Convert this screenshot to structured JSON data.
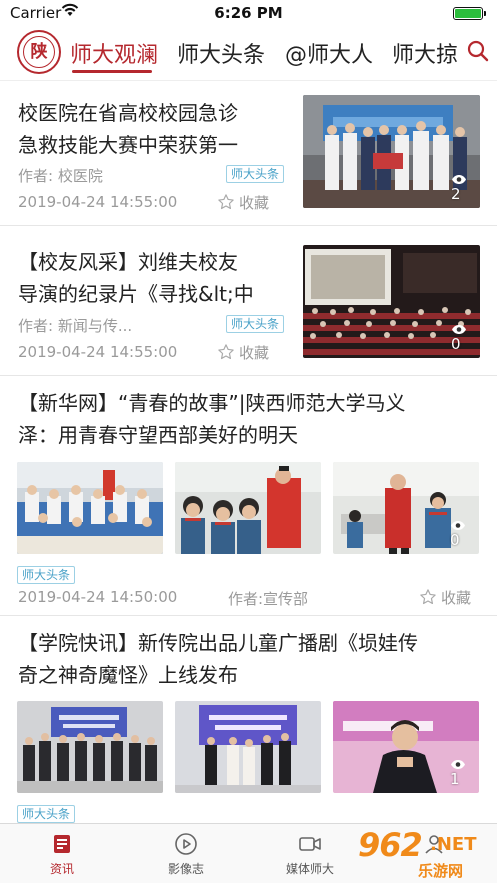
{
  "status": {
    "carrier": "Carrier",
    "time": "6:26 PM"
  },
  "logo": {
    "char": "陕"
  },
  "nav": {
    "tabs": [
      "师大观澜",
      "师大头条",
      "@师大人",
      "师大掠"
    ],
    "active": 0
  },
  "articles": [
    {
      "title_lines": [
        "校医院在省高校校园急诊",
        "急救技能大赛中荣获第一"
      ],
      "author": "作者: 校医院",
      "tag": "师大头条",
      "date": "2019-04-24 14:55:00",
      "fav": "收藏",
      "views": "2",
      "thumb_text": "陕西省高校校园"
    },
    {
      "title_lines": [
        "【校友风采】刘维夫校友",
        "导演的纪录片《寻找&lt;中"
      ],
      "author": "作者: 新闻与传...",
      "tag": "师大头条",
      "date": "2019-04-24 14:55:00",
      "fav": "收藏",
      "views": "0",
      "thumb_text": "寻找中国"
    },
    {
      "title_lines": [
        "【新华网】“青春的故事”|陕西师范大学马义",
        "泽：用青春守望西部美好的明天"
      ],
      "tag": "师大头条",
      "date": "2019-04-24 14:50:00",
      "author": "作者:宣传部",
      "fav": "收藏",
      "views": "0"
    },
    {
      "title_lines": [
        "【学院快讯】新传院出品儿童广播剧《埙娃传",
        "奇之神奇魔怪》上线发布"
      ],
      "tag": "师大头条",
      "views": "1",
      "thumb_text": "奇魔怪》"
    }
  ],
  "tabbar": [
    {
      "label": "资讯",
      "icon": "news-icon"
    },
    {
      "label": "影像志",
      "icon": "play-icon"
    },
    {
      "label": "媒体师大",
      "icon": "video-camera-icon"
    },
    {
      "label": "",
      "icon": "user-icon"
    }
  ],
  "watermark": {
    "brand": "962",
    "net": ".NET",
    "sub": "乐游网"
  },
  "colors": {
    "accent": "#b5282e",
    "tag": "#4aa2c8",
    "meta": "#9a9a9a"
  }
}
